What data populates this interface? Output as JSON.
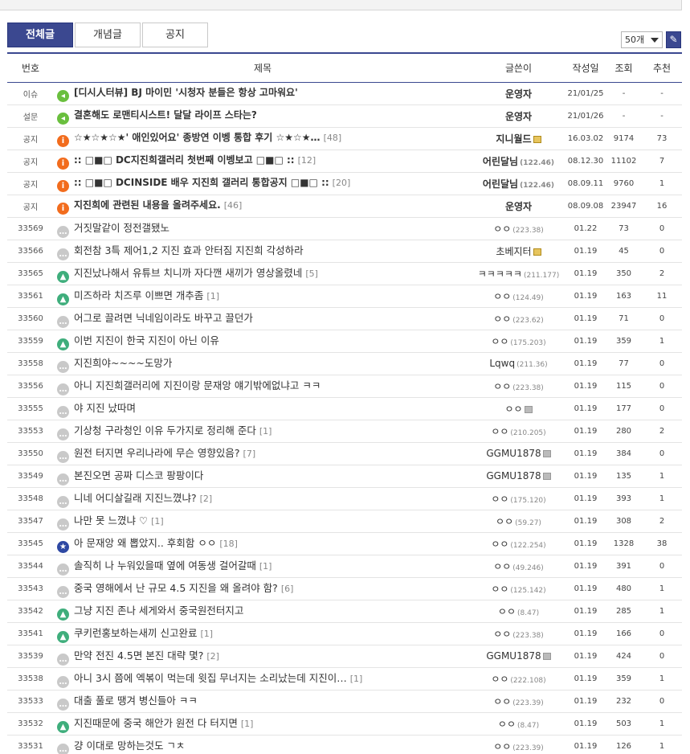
{
  "tabs": [
    {
      "label": "전체글",
      "active": true
    },
    {
      "label": "개념글",
      "active": false
    },
    {
      "label": "공지",
      "active": false
    }
  ],
  "list_size": {
    "selected": "50개"
  },
  "write_icon": "pencil-icon",
  "columns": [
    "번호",
    "제목",
    "글쓴이",
    "작성일",
    "조회",
    "추천"
  ],
  "notices": [
    {
      "num": "이슈",
      "icon": "speaker",
      "title": "[디시人터뷰] BJ 마이민 '시청자 분들은 항상 고마워요'",
      "reply": "",
      "writer": "운영자",
      "ip": "",
      "tag": "",
      "date": "21/01/25",
      "views": "-",
      "recs": "-"
    },
    {
      "num": "설문",
      "icon": "speaker",
      "title": "결혼해도 로맨티시스트! 달달 라이프 스타는?",
      "reply": "",
      "writer": "운영자",
      "ip": "",
      "tag": "",
      "date": "21/01/26",
      "views": "-",
      "recs": "-"
    },
    {
      "num": "공지",
      "icon": "info",
      "title": "☆★☆★☆★' 애인있어요' 종방연 이벵 통합 후기 ☆★☆★…",
      "reply": "[48]",
      "writer": "지니월드",
      "ip": "",
      "tag": "gold",
      "date": "16.03.02",
      "views": "9174",
      "recs": "73"
    },
    {
      "num": "공지",
      "icon": "info",
      "title": ":: □■□ DC지진희갤러리 첫번째 이벵보고 □■□ ::",
      "reply": "[12]",
      "writer": "어린달님",
      "ip": "(122.46)",
      "tag": "",
      "date": "08.12.30",
      "views": "11102",
      "recs": "7"
    },
    {
      "num": "공지",
      "icon": "info",
      "title": ":: □■□ DCINSIDE 배우 지진희 갤러리 통합공지 □■□ ::",
      "reply": "[20]",
      "writer": "어린달님",
      "ip": "(122.46)",
      "tag": "",
      "date": "08.09.11",
      "views": "9760",
      "recs": "1"
    },
    {
      "num": "공지",
      "icon": "info",
      "title": "지진희에 관련된 내용을 올려주세요.",
      "reply": "[46]",
      "writer": "운영자",
      "ip": "",
      "tag": "",
      "date": "08.09.08",
      "views": "23947",
      "recs": "16"
    }
  ],
  "posts": [
    {
      "num": "33569",
      "icon": "text",
      "title": "거짓말같이 정전갤됐노",
      "reply": "",
      "writer": "ㅇㅇ",
      "ip": "(223.38)",
      "tag": "",
      "date": "01.22",
      "views": "73",
      "recs": "0"
    },
    {
      "num": "33566",
      "icon": "text",
      "title": "회전참 3특 제어1,2 지진 효과 안터짐 지진희 각성하라",
      "reply": "",
      "writer": "초베지터",
      "ip": "",
      "tag": "gold",
      "date": "01.19",
      "views": "45",
      "recs": "0"
    },
    {
      "num": "33565",
      "icon": "image",
      "title": "지진났나해서 유튜브 치니까 자다깬 새끼가 영상올렸네",
      "reply": "[5]",
      "writer": "ㅋㅋㅋㅋㅋ",
      "ip": "(211.177)",
      "tag": "",
      "date": "01.19",
      "views": "350",
      "recs": "2"
    },
    {
      "num": "33561",
      "icon": "image",
      "title": "미즈하라 치즈루 이쁘면 개추좀",
      "reply": "[1]",
      "writer": "ㅇㅇ",
      "ip": "(124.49)",
      "tag": "",
      "date": "01.19",
      "views": "163",
      "recs": "11"
    },
    {
      "num": "33560",
      "icon": "text",
      "title": "어그로 끌려면 닉네임이라도 바꾸고 끌던가",
      "reply": "",
      "writer": "ㅇㅇ",
      "ip": "(223.62)",
      "tag": "",
      "date": "01.19",
      "views": "71",
      "recs": "0"
    },
    {
      "num": "33559",
      "icon": "image",
      "title": "이번 지진이 한국 지진이 아닌 이유",
      "reply": "",
      "writer": "ㅇㅇ",
      "ip": "(175.203)",
      "tag": "",
      "date": "01.19",
      "views": "359",
      "recs": "1"
    },
    {
      "num": "33558",
      "icon": "text",
      "title": "지진희야~~~~도망가",
      "reply": "",
      "writer": "Lqwq",
      "ip": "(211.36)",
      "tag": "",
      "date": "01.19",
      "views": "77",
      "recs": "0"
    },
    {
      "num": "33556",
      "icon": "text",
      "title": "아니 지진희갤러리에 지진이랑 문재앙 얘기밖에없냐고 ㅋㅋ",
      "reply": "",
      "writer": "ㅇㅇ",
      "ip": "(223.38)",
      "tag": "",
      "date": "01.19",
      "views": "115",
      "recs": "0"
    },
    {
      "num": "33555",
      "icon": "text",
      "title": "야 지진 났따며",
      "reply": "",
      "writer": "ㅇㅇ",
      "ip": "",
      "tag": "grey",
      "date": "01.19",
      "views": "177",
      "recs": "0"
    },
    {
      "num": "33553",
      "icon": "text",
      "title": "기상청 구라청인 이유 두가지로 정리해 준다",
      "reply": "[1]",
      "writer": "ㅇㅇ",
      "ip": "(210.205)",
      "tag": "",
      "date": "01.19",
      "views": "280",
      "recs": "2"
    },
    {
      "num": "33550",
      "icon": "text",
      "title": "원전 터지면 우리나라에 무슨 영향있음?",
      "reply": "[7]",
      "writer": "GGMU1878",
      "ip": "",
      "tag": "grey",
      "date": "01.19",
      "views": "384",
      "recs": "0"
    },
    {
      "num": "33549",
      "icon": "text",
      "title": "본진오면 공짜 디스코 팡팡이다",
      "reply": "",
      "writer": "GGMU1878",
      "ip": "",
      "tag": "grey",
      "date": "01.19",
      "views": "135",
      "recs": "1"
    },
    {
      "num": "33548",
      "icon": "text",
      "title": "니네 어디살길래 지진느꼈냐?",
      "reply": "[2]",
      "writer": "ㅇㅇ",
      "ip": "(175.120)",
      "tag": "",
      "date": "01.19",
      "views": "393",
      "recs": "1"
    },
    {
      "num": "33547",
      "icon": "text",
      "title": "나만 못 느꼈냐 ♡",
      "reply": "[1]",
      "writer": "ㅇㅇ",
      "ip": "(59.27)",
      "tag": "",
      "date": "01.19",
      "views": "308",
      "recs": "2"
    },
    {
      "num": "33545",
      "icon": "star",
      "title": "아 문재앙 왜 뽑았지.. 후회함 ㅇㅇ",
      "reply": "[18]",
      "writer": "ㅇㅇ",
      "ip": "(122.254)",
      "tag": "",
      "date": "01.19",
      "views": "1328",
      "recs": "38"
    },
    {
      "num": "33544",
      "icon": "text",
      "title": "솔직히 나 누워있을때 옆에 여동생 걸어갈때",
      "reply": "[1]",
      "writer": "ㅇㅇ",
      "ip": "(49.246)",
      "tag": "",
      "date": "01.19",
      "views": "391",
      "recs": "0"
    },
    {
      "num": "33543",
      "icon": "text",
      "title": "중국 영해에서 난 규모 4.5 지진을 왜 올려야 함?",
      "reply": "[6]",
      "writer": "ㅇㅇ",
      "ip": "(125.142)",
      "tag": "",
      "date": "01.19",
      "views": "480",
      "recs": "1"
    },
    {
      "num": "33542",
      "icon": "image",
      "title": "그냥 지진 존나 세게와서 중국원전터지고",
      "reply": "",
      "writer": "ㅇㅇ",
      "ip": "(8.47)",
      "tag": "",
      "date": "01.19",
      "views": "285",
      "recs": "1"
    },
    {
      "num": "33541",
      "icon": "image",
      "title": "쿠키런홍보하는새끼 신고완료",
      "reply": "[1]",
      "writer": "ㅇㅇ",
      "ip": "(223.38)",
      "tag": "",
      "date": "01.19",
      "views": "166",
      "recs": "0"
    },
    {
      "num": "33539",
      "icon": "text",
      "title": "만약 전진 4.5면 본진 대략 몇?",
      "reply": "[2]",
      "writer": "GGMU1878",
      "ip": "",
      "tag": "grey",
      "date": "01.19",
      "views": "424",
      "recs": "0"
    },
    {
      "num": "33538",
      "icon": "text",
      "title": "아니 3시 쯤에 엑볶이 먹는데 윗집 무너지는 소리났는데 지진이…",
      "reply": "[1]",
      "writer": "ㅇㅇ",
      "ip": "(222.108)",
      "tag": "",
      "date": "01.19",
      "views": "359",
      "recs": "1"
    },
    {
      "num": "33533",
      "icon": "text",
      "title": "대출 풀로 땡겨 병신들아 ㅋㅋ",
      "reply": "",
      "writer": "ㅇㅇ",
      "ip": "(223.39)",
      "tag": "",
      "date": "01.19",
      "views": "232",
      "recs": "0"
    },
    {
      "num": "33532",
      "icon": "image",
      "title": "지진때문에 중국 해안가 원전 다 터지면",
      "reply": "[1]",
      "writer": "ㅇㅇ",
      "ip": "(8.47)",
      "tag": "",
      "date": "01.19",
      "views": "503",
      "recs": "1"
    },
    {
      "num": "33531",
      "icon": "text",
      "title": "걍 이대로 망하는것도 ㄱㅊ",
      "reply": "",
      "writer": "ㅇㅇ",
      "ip": "(223.39)",
      "tag": "",
      "date": "01.19",
      "views": "126",
      "recs": "1"
    }
  ]
}
